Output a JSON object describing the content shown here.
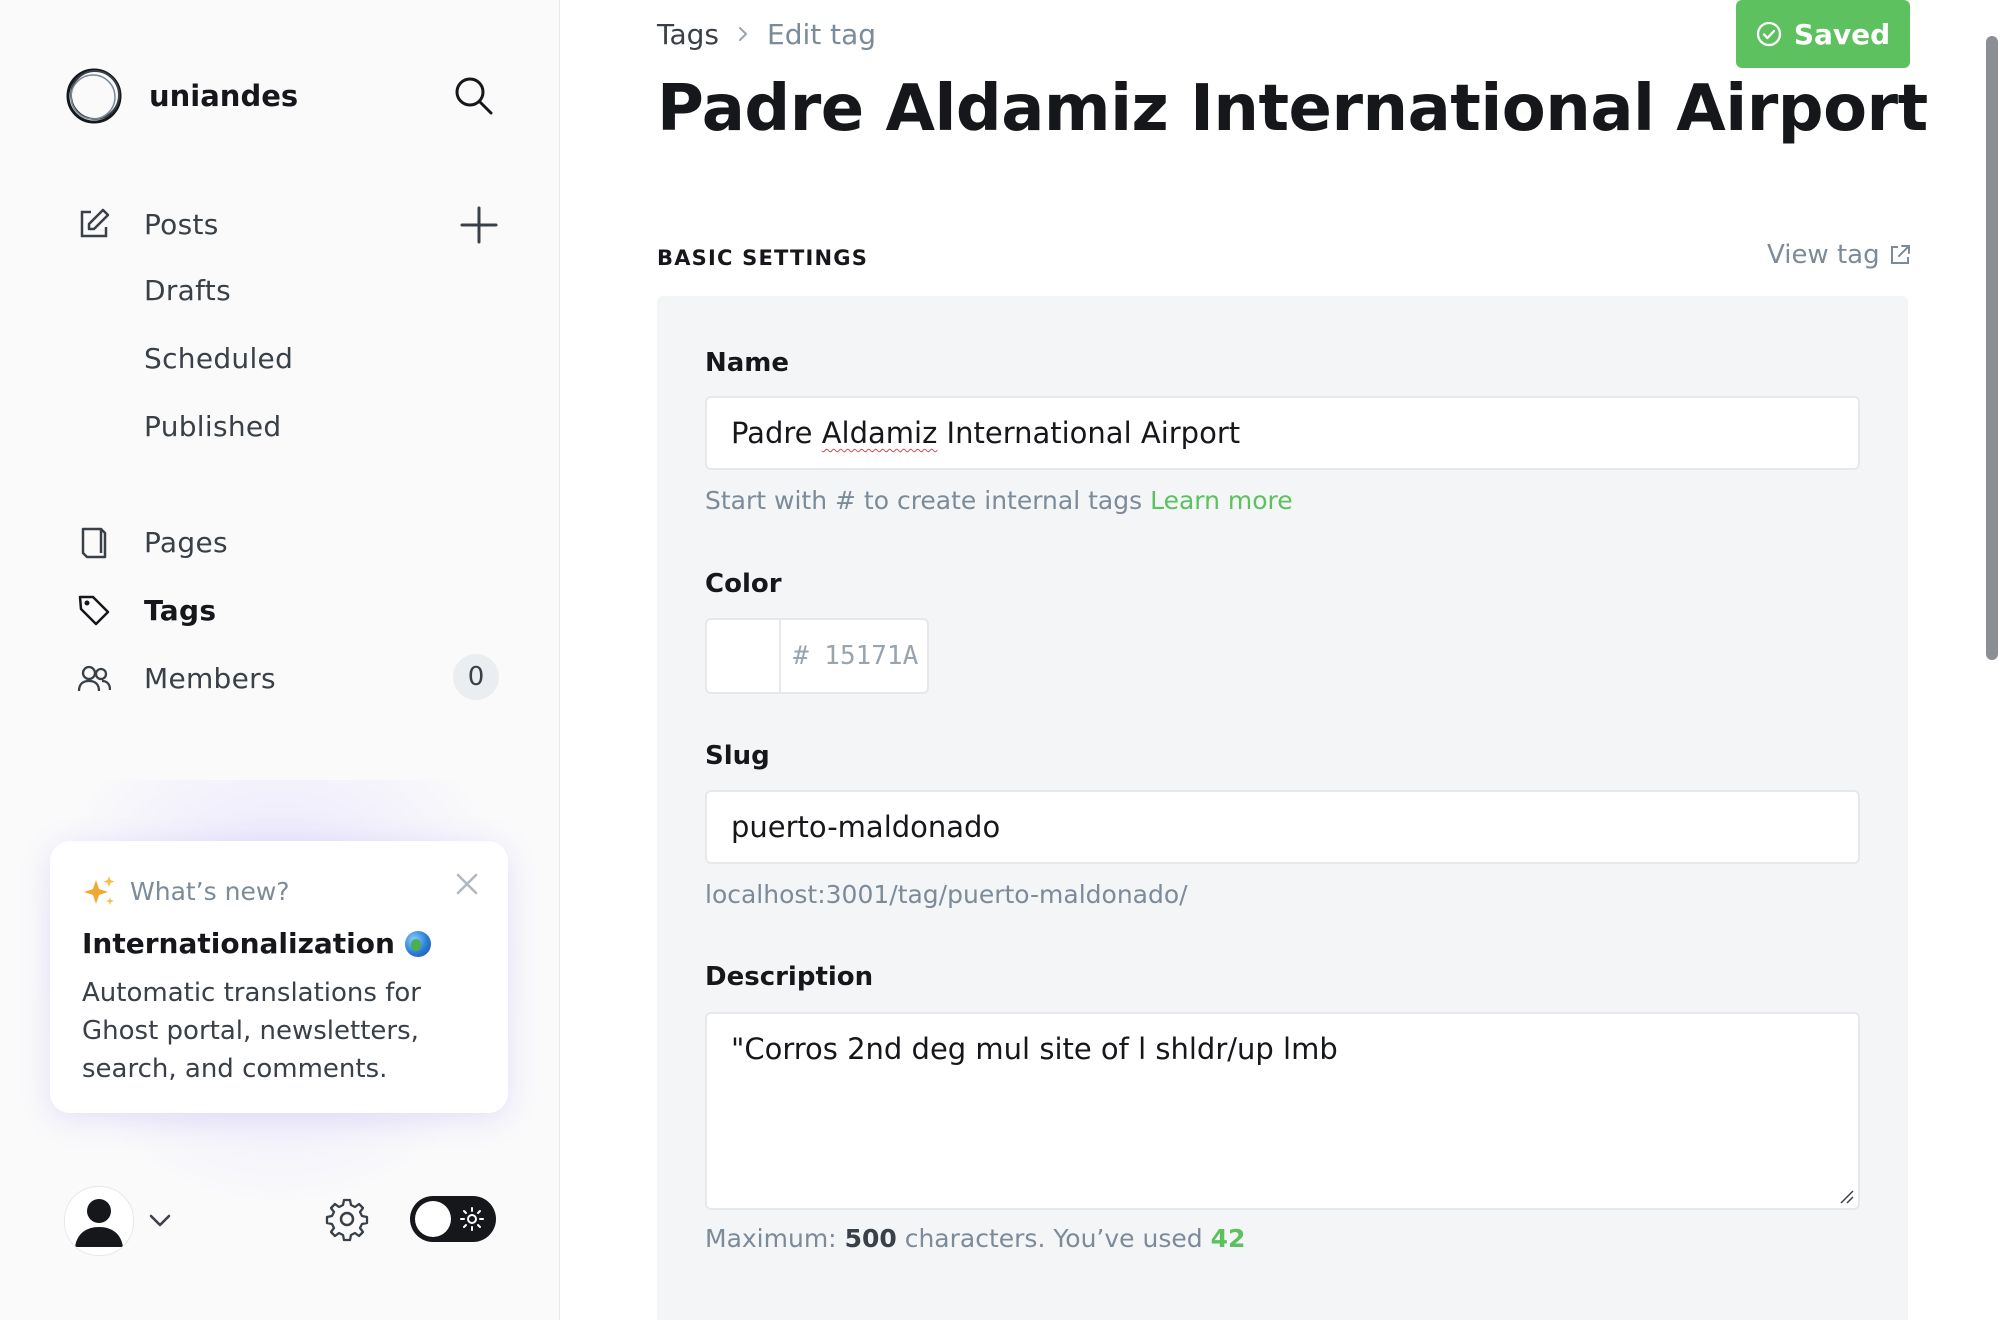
{
  "sidebar": {
    "brand": "uniandes",
    "nav": {
      "posts": "Posts",
      "drafts": "Drafts",
      "scheduled": "Scheduled",
      "published": "Published",
      "pages": "Pages",
      "tags": "Tags",
      "members": "Members",
      "members_count": "0"
    },
    "whats_new": {
      "label": "What’s new?",
      "title": "Internationalization",
      "body": "Automatic translations for Ghost portal, newsletters, search, and comments."
    },
    "icons": [
      "logo-icon",
      "search-icon",
      "edit-icon",
      "plus-icon",
      "pages-icon",
      "tag-icon",
      "members-icon",
      "sparkle-icon",
      "close-icon",
      "user-icon",
      "chevron-down-icon",
      "gear-icon",
      "sun-icon"
    ]
  },
  "header": {
    "breadcrumb_root": "Tags",
    "breadcrumb_current": "Edit tag",
    "saved_label": "Saved",
    "title": "Padre Aldamiz International Airport"
  },
  "form": {
    "section_label": "BASIC SETTINGS",
    "view_tag": "View tag",
    "name_label": "Name",
    "name_value_pre": "Padre ",
    "name_value_misspelled": "Aldamiz",
    "name_value_post": " International Airport",
    "name_hint": "Start with # to create internal tags",
    "name_hint_link": "Learn more",
    "color_label": "Color",
    "color_value": "# 15171A",
    "slug_label": "Slug",
    "slug_value": "puerto-maldonado",
    "slug_url": "localhost:3001/tag/puerto-maldonado/",
    "description_label": "Description",
    "description_value": "\"Corros 2nd deg mul site of l shldr/up lmb",
    "desc_hint_pre": "Maximum:",
    "desc_hint_max": "500",
    "desc_hint_mid": "characters. You’ve used",
    "desc_hint_used": "42"
  },
  "colors": {
    "accent": "#5cc15e",
    "text": "#15171a",
    "muted": "#7c8b9a",
    "panel": "#f4f5f6"
  }
}
